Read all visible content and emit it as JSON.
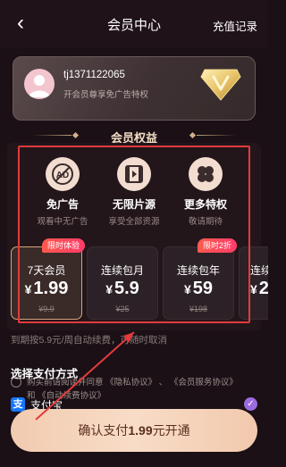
{
  "header": {
    "back_icon": "back-chevron-icon",
    "title": "会员中心",
    "recharge_label": "充值记录"
  },
  "member_card": {
    "username": "tj1371122065",
    "subtitle": "开会员尊享免广告特权",
    "badge_icon": "vip-gold-badge-icon"
  },
  "benefits": {
    "heading": "会员权益",
    "items": [
      {
        "name": "免广告",
        "desc": "观看中无广告",
        "icon": "no-ad-icon"
      },
      {
        "name": "无限片源",
        "desc": "享受全部资源",
        "icon": "film-icon"
      },
      {
        "name": "更多特权",
        "desc": "敬请期待",
        "icon": "clover-grid-icon"
      }
    ]
  },
  "plans": [
    {
      "name": "7天会员",
      "currency": "¥",
      "price": "1.99",
      "original": "¥9.9",
      "tag": "限时体验",
      "selected": true
    },
    {
      "name": "连续包月",
      "currency": "¥",
      "price": "5.9",
      "original": "¥25",
      "tag": "",
      "selected": false
    },
    {
      "name": "连续包年",
      "currency": "¥",
      "price": "59",
      "original": "¥198",
      "tag": "限时2折",
      "selected": false
    },
    {
      "name": "连续",
      "currency": "¥",
      "price": "2",
      "original": "",
      "tag": "",
      "selected": false
    }
  ],
  "renew_note": "到期按5.9元/周自动续费，可随时取消",
  "payment": {
    "title": "选择支付方式",
    "agreement_line1": "购买前请阅读并同意 《隐私协议》 、 《会员服务协议》",
    "agreement_line2": "和 《自动续费协议》",
    "method_label": "支付宝",
    "method_icon": "alipay-icon",
    "method_selected": true
  },
  "confirm": {
    "prefix": "确认支付",
    "amount": "1.99",
    "suffix": "元开通"
  },
  "colors": {
    "background": "#1a1016",
    "highlight_frame": "#e23b3b",
    "accent_gold": "#d6a67a",
    "button_peach": "#f4d2bb",
    "check_purple": "#9b6bde"
  }
}
